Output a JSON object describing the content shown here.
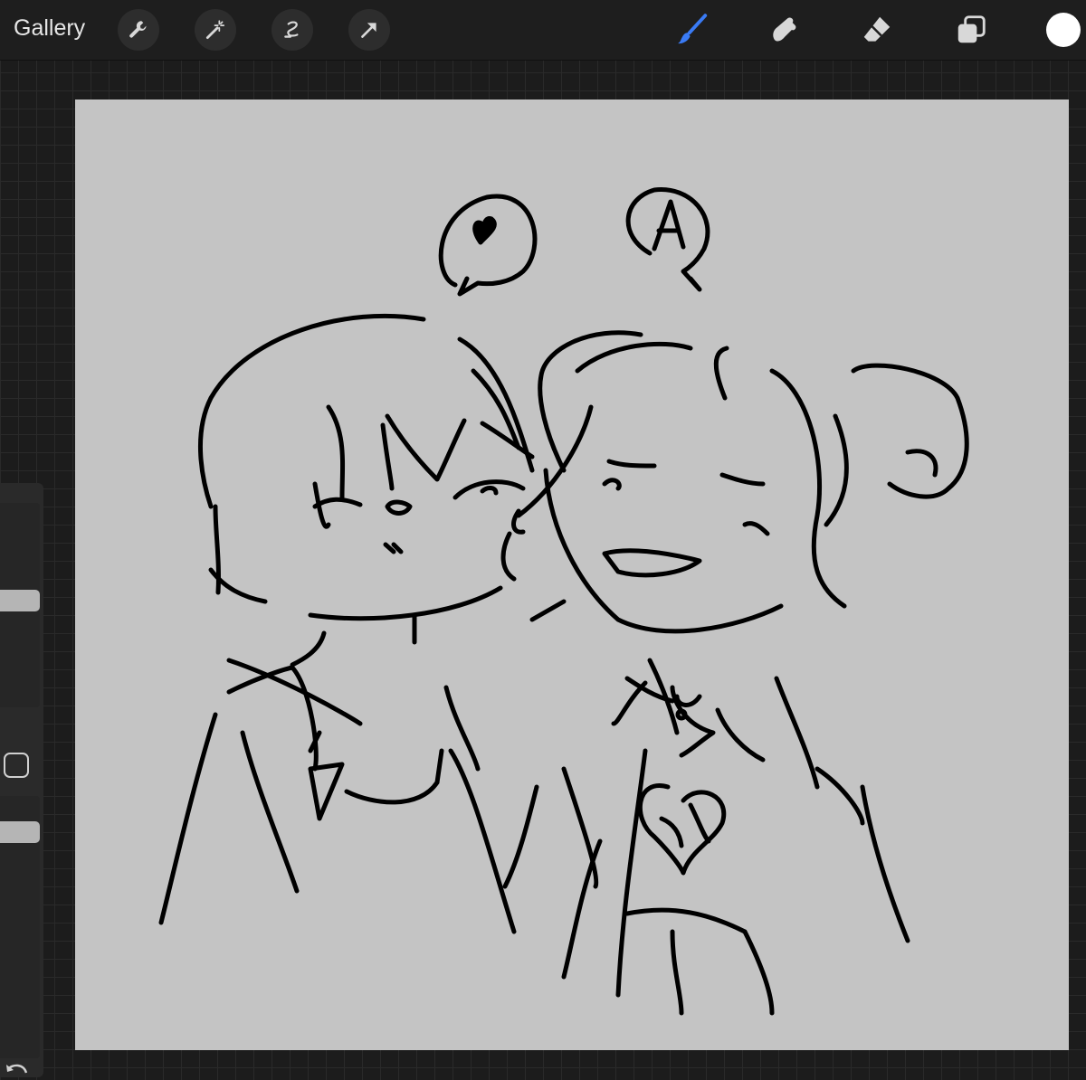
{
  "toolbar": {
    "gallery_label": "Gallery",
    "left_tools": [
      "wrench-icon",
      "magic-wand-icon",
      "selection-icon",
      "transform-arrow-icon"
    ],
    "right_tools": [
      "brush-icon",
      "smudge-icon",
      "eraser-icon",
      "layers-icon"
    ],
    "active_tool": "brush-icon",
    "active_color": "#3a7bf5",
    "current_color": "#ffffff"
  },
  "canvas": {
    "background": "#c4c4c4",
    "stroke_color": "#000000"
  },
  "sidebar": {
    "brush_size_level": 0.72,
    "opacity_level": 0.55
  }
}
